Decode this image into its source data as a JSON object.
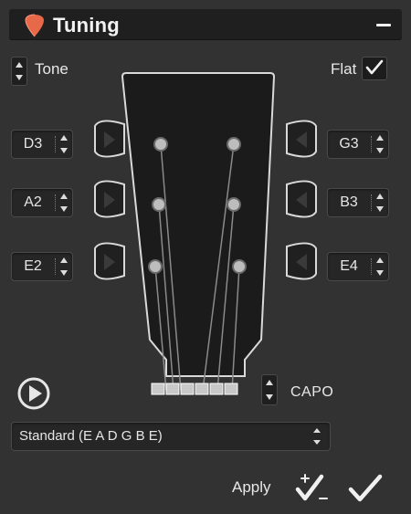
{
  "panel": {
    "title": "Tuning",
    "title_icon": "guitar-pick-icon",
    "collapse_icon": "minus-icon"
  },
  "controls": {
    "tone_label": "Tone",
    "flat_label": "Flat",
    "flat_checked": true
  },
  "strings_left": [
    {
      "note": "D3"
    },
    {
      "note": "A2"
    },
    {
      "note": "E2"
    }
  ],
  "strings_right": [
    {
      "note": "G3"
    },
    {
      "note": "B3"
    },
    {
      "note": "E4"
    }
  ],
  "capo": {
    "label": "CAPO"
  },
  "tuning_preset": {
    "selected": "Standard (E A D G B E)"
  },
  "footer": {
    "apply_label": "Apply"
  },
  "colors": {
    "accent_pick": "#e8694a",
    "headstock_fill": "#1b1b1b",
    "outline": "#d9d9d9"
  }
}
